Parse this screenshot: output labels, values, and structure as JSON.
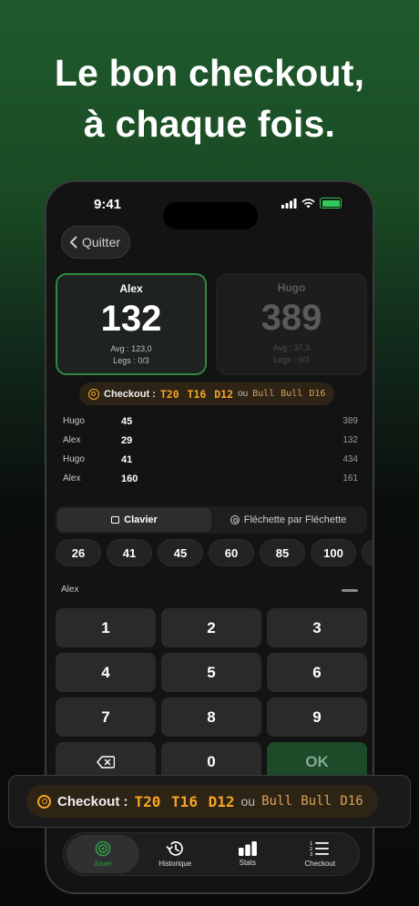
{
  "headline": {
    "line1": "Le bon checkout,",
    "line2": "à chaque fois."
  },
  "status_bar": {
    "time": "9:41"
  },
  "nav": {
    "back_label": "Quitter"
  },
  "players": [
    {
      "name": "Alex",
      "score": "132",
      "avg": "Avg : 123,0",
      "legs": "Legs : 0/3",
      "active": true
    },
    {
      "name": "Hugo",
      "score": "389",
      "avg": "Avg : 37,3",
      "legs": "Legs : 0/3",
      "active": false
    }
  ],
  "checkout": {
    "label": "Checkout :",
    "main": "T20 T16 D12",
    "or": "ou",
    "alt": "Bull Bull D16"
  },
  "history": [
    {
      "name": "Hugo",
      "score": "45",
      "remaining": "389"
    },
    {
      "name": "Alex",
      "score": "29",
      "remaining": "132"
    },
    {
      "name": "Hugo",
      "score": "41",
      "remaining": "434"
    },
    {
      "name": "Alex",
      "score": "160",
      "remaining": "161"
    }
  ],
  "mode_tabs": [
    {
      "label": "Clavier",
      "selected": true
    },
    {
      "label": "Fléchette par Fléchette",
      "selected": false
    }
  ],
  "quick_scores": [
    "26",
    "41",
    "45",
    "60",
    "85",
    "100",
    "1"
  ],
  "input": {
    "player_label": "Alex"
  },
  "keypad": {
    "keys": [
      "1",
      "2",
      "3",
      "4",
      "5",
      "6",
      "7",
      "8",
      "9",
      "",
      "0",
      "OK"
    ]
  },
  "tabbar": [
    {
      "label": "Jouer",
      "icon": "target-icon",
      "active": true
    },
    {
      "label": "Historique",
      "icon": "history-icon",
      "active": false
    },
    {
      "label": "Stats",
      "icon": "stats-icon",
      "active": false
    },
    {
      "label": "Checkout",
      "icon": "checklist-icon",
      "active": false
    }
  ],
  "colors": {
    "accent_green": "#2e8b3e",
    "checkout_orange": "#f5a623"
  }
}
